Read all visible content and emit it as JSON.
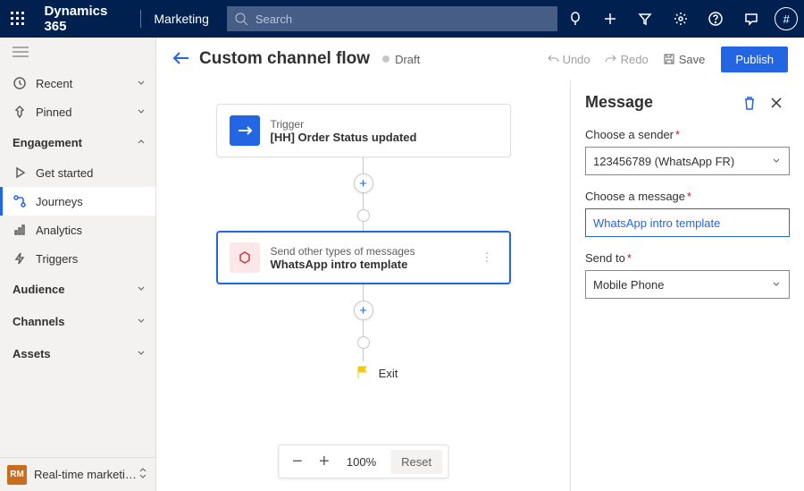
{
  "topnav": {
    "brand": "Dynamics 365",
    "area": "Marketing",
    "search_placeholder": "Search",
    "avatar_initial": "#"
  },
  "sidebar": {
    "recent": "Recent",
    "pinned": "Pinned",
    "groups": {
      "engagement": "Engagement",
      "audience": "Audience",
      "channels": "Channels",
      "assets": "Assets"
    },
    "items": {
      "get_started": "Get started",
      "journeys": "Journeys",
      "analytics": "Analytics",
      "triggers": "Triggers"
    },
    "area_switcher": {
      "badge": "RM",
      "name": "Real-time marketi…"
    }
  },
  "cmdbar": {
    "title": "Custom channel flow",
    "status": "Draft",
    "undo": "Undo",
    "redo": "Redo",
    "save": "Save",
    "publish": "Publish"
  },
  "flow": {
    "trigger": {
      "label": "Trigger",
      "title": "[HH] Order Status updated"
    },
    "msg": {
      "label": "Send other types of messages",
      "title": "WhatsApp intro template"
    },
    "exit": "Exit",
    "zoom": {
      "value": "100%",
      "reset": "Reset"
    }
  },
  "props": {
    "title": "Message",
    "sender_label": "Choose a sender",
    "sender_value": "123456789 (WhatsApp FR)",
    "message_label": "Choose a message",
    "message_value": "WhatsApp intro template",
    "sendto_label": "Send to",
    "sendto_value": "Mobile Phone"
  }
}
